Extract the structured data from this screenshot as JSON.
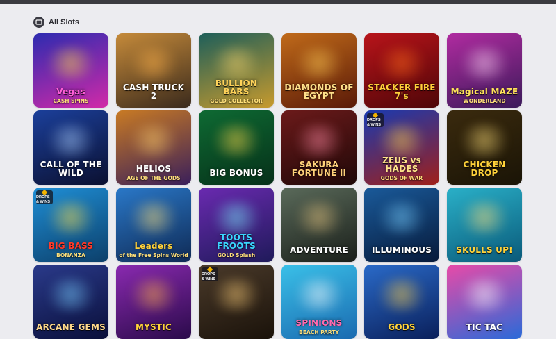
{
  "header": {
    "title": "All Slots",
    "icon": "slots-logo-icon"
  },
  "tiles": [
    {
      "title": "Vegas",
      "subtitle": "CASH SPINS",
      "bg1": "#2d2bb0",
      "bg2": "#d22aa8",
      "glow": "#ffd84a",
      "color": "#ff5fd8",
      "badge": ""
    },
    {
      "title": "CASH TRUCK 2",
      "subtitle": "",
      "bg1": "#c58a3a",
      "bg2": "#3a2a1c",
      "glow": "#ffb24a",
      "color": "#ffffff",
      "badge": ""
    },
    {
      "title": "BULLION BARS",
      "subtitle": "GOLD COLLECTOR",
      "bg1": "#1e5f5a",
      "bg2": "#c79a2d",
      "glow": "#f7d36b",
      "color": "#ffd35a",
      "badge": ""
    },
    {
      "title": "DIAMONDS OF EGYPT",
      "subtitle": "",
      "bg1": "#c06a1a",
      "bg2": "#5a1a08",
      "glow": "#ffcc55",
      "color": "#ffe08a",
      "badge": ""
    },
    {
      "title": "STACKER FIRE 7's",
      "subtitle": "",
      "bg1": "#b8141a",
      "bg2": "#4e0608",
      "glow": "#ff6a1a",
      "color": "#ffcf3a",
      "badge": ""
    },
    {
      "title": "Magical MAZE",
      "subtitle": "WONDERLAND",
      "bg1": "#b02ba0",
      "bg2": "#3b1a5a",
      "glow": "#ffd6f6",
      "color": "#ffe25a",
      "badge": ""
    },
    {
      "title": "CALL OF THE WILD",
      "subtitle": "",
      "bg1": "#1b3f9a",
      "bg2": "#0b1030",
      "glow": "#aacfff",
      "color": "#ffffff",
      "badge": ""
    },
    {
      "title": "HELIOS",
      "subtitle": "AGE OF THE GODS",
      "bg1": "#c87a24",
      "bg2": "#3a1f5a",
      "glow": "#ffcf6b",
      "color": "#ffffff",
      "badge": ""
    },
    {
      "title": "BIG BONUS",
      "subtitle": "",
      "bg1": "#0e6a33",
      "bg2": "#063019",
      "glow": "#ffd94a",
      "color": "#ffffff",
      "badge": ""
    },
    {
      "title": "SAKURA FORTUNE II",
      "subtitle": "",
      "bg1": "#6b1a1a",
      "bg2": "#1f0808",
      "glow": "#ff8aa5",
      "color": "#ffd27a",
      "badge": ""
    },
    {
      "title": "ZEUS vs HADES",
      "subtitle": "GODS OF WAR",
      "bg1": "#1a3ab0",
      "bg2": "#a0201a",
      "glow": "#ffd04a",
      "color": "#ffe38a",
      "badge": "DROPS & WINS"
    },
    {
      "title": "CHICKEN DROP",
      "subtitle": "",
      "bg1": "#3a2a0e",
      "bg2": "#1a1406",
      "glow": "#ffe07a",
      "color": "#ffd23a",
      "badge": ""
    },
    {
      "title": "BIG BASS",
      "subtitle": "BONANZA",
      "bg1": "#1f8fd6",
      "bg2": "#0c3f6a",
      "glow": "#ffe04a",
      "color": "#ff3a2a",
      "badge": "DROPS & WINS"
    },
    {
      "title": "Leaders",
      "subtitle": "of the Free Spins World",
      "bg1": "#2a78c8",
      "bg2": "#0f2a55",
      "glow": "#ffe07a",
      "color": "#ffd23a",
      "badge": ""
    },
    {
      "title": "TOOTS FROOTS",
      "subtitle": "GOLD Splash",
      "bg1": "#6a2ab0",
      "bg2": "#1f1a5a",
      "glow": "#7af0ff",
      "color": "#3ad6ff",
      "badge": ""
    },
    {
      "title": "ADVENTURE",
      "subtitle": "",
      "bg1": "#5a6a5a",
      "bg2": "#1a1f1a",
      "glow": "#e8c680",
      "color": "#ffffff",
      "badge": ""
    },
    {
      "title": "ILLUMINOUS",
      "subtitle": "",
      "bg1": "#1a5a9a",
      "bg2": "#071a3a",
      "glow": "#7ad0ff",
      "color": "#ffffff",
      "badge": ""
    },
    {
      "title": "SKULLS UP!",
      "subtitle": "",
      "bg1": "#2ab0c8",
      "bg2": "#0a5a7a",
      "glow": "#ffe07a",
      "color": "#ffd23a",
      "badge": ""
    },
    {
      "title": "ARCANE GEMS",
      "subtitle": "",
      "bg1": "#2a3a8a",
      "bg2": "#0a0f3a",
      "glow": "#7acfff",
      "color": "#ffd98a",
      "badge": ""
    },
    {
      "title": "MYSTIC",
      "subtitle": "",
      "bg1": "#8a2ab0",
      "bg2": "#2a0a4a",
      "glow": "#ffb04a",
      "color": "#ffd23a",
      "badge": ""
    },
    {
      "title": "",
      "subtitle": "",
      "bg1": "#4a3a2a",
      "bg2": "#1a120a",
      "glow": "#ffd07a",
      "color": "#ffffff",
      "badge": "DROPS & WINS"
    },
    {
      "title": "SPINIONS",
      "subtitle": "BEACH PARTY",
      "bg1": "#3ac0e8",
      "bg2": "#1a6ab0",
      "glow": "#ffffff",
      "color": "#ff6ab0",
      "badge": ""
    },
    {
      "title": "GODS",
      "subtitle": "",
      "bg1": "#2a6ac8",
      "bg2": "#0a1f5a",
      "glow": "#ffd04a",
      "color": "#ffd23a",
      "badge": ""
    },
    {
      "title": "TIC TAC",
      "subtitle": "",
      "bg1": "#e84aa8",
      "bg2": "#2a6ad8",
      "glow": "#ffffff",
      "color": "#ffffff",
      "badge": ""
    }
  ]
}
